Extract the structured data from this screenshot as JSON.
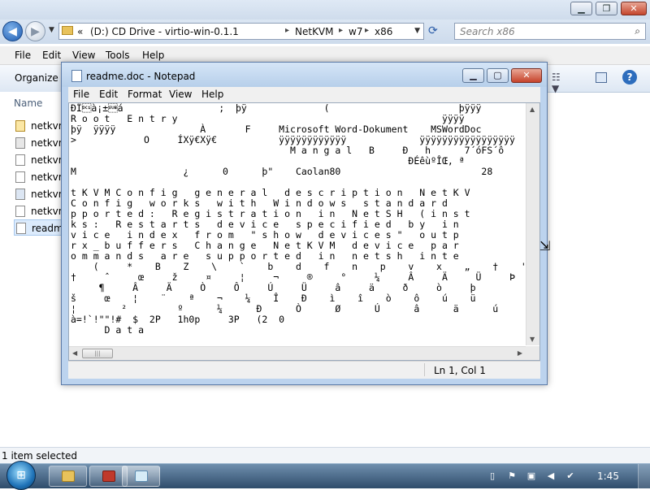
{
  "explorer": {
    "breadcrumb": [
      "«",
      "(D:) CD Drive - virtio-win-0.1.1",
      "NetKVM",
      "w7",
      "x86"
    ],
    "search_placeholder": "Search x86",
    "menu": [
      "File",
      "Edit",
      "View",
      "Tools",
      "Help"
    ],
    "organize_label": "Organize",
    "column_header": "Name",
    "files": [
      {
        "name": "netkvm",
        "icon": "inf-file-icon"
      },
      {
        "name": "netkvm",
        "icon": "gear-file-icon"
      },
      {
        "name": "netkvm",
        "icon": "document-icon"
      },
      {
        "name": "netkvm",
        "icon": "catalog-icon"
      },
      {
        "name": "netkvm",
        "icon": "sys-file-icon"
      },
      {
        "name": "netkvm",
        "icon": "document-icon"
      },
      {
        "name": "readm",
        "icon": "text-file-icon"
      }
    ],
    "status": "1 item selected"
  },
  "notepad": {
    "title": "readme.doc - Notepad",
    "menu": [
      "File",
      "Edit",
      "Format",
      "View",
      "Help"
    ],
    "content": "ÐÏ\u0011à¡±\u001aá                 ;  þÿ     \t     (        \t     \t     þÿÿÿ\nR o o t   E n t r y                                               ÿÿÿÿ\nþÿ  ÿÿÿÿ      \t       À       F     Microsoft Word-Dokument    MSWordDoc  \t  \n>\t     O     ÍXÿ€Xÿ€  \t     ÿÿÿÿÿÿÿÿÿÿÿÿ   \t      ÿÿÿÿÿÿÿÿÿÿÿÿÿÿÿÿÿ\n                                       M a n g a l   B     Ð   h      7´óFS´ô\n                                                            ÐÉêùºÎŒ, ª\nM        \t    ¿      0      þ\"    Caolan80                         28  \n\nt K V M C o n f i g   g e n e r a l   d e s c r i p t i o n   N e t K V\nC o n f i g   w o r k s   w i t h   W i n d o w s   s t a n d a r d\np p o r t e d :   R e g i s t r a t i o n   i n   N e t S H   ( i n s t\nk s :   R e s t a r t s   d e v i c e   s p e c i f i e d   b y   i n\nv i c e   i n d e x   f r o m   \" s h o w   d e v i c e s \"   o u t p\nr x _ b u f f e r s   C h a n g e   N e t K V M   d e v i c e   p a r\no m m a n d s   a r e   s u p p o r t e d   i n   n e t s h   i n t e\n    (     *    B    Z    \\    `    b    d    f    n    p    v    x    „    †    '    \"    ˜    ª    É\n†     ˆ     œ     ž     ¤     ¦     ¬     ®     °     ¼     Â     Ä     Ü     Þ     â     æ     î     ð     ò     ø\n     ¶     Â     Ä     Ò     Ô     Ú     Ü     â     ä     ð     ò     þ               \"     .     0     8\nš     œ    ¦    ¨    ª    ¬    ¼    Î    Ð    ì    î    ò    ô    ú    ü         (    *    <\n¦        ²         º      ¼      Ð      Ò      Ø      Ú      â      ä      ú      ü      !      !      !      *!  ,\nà=!`!\"\"!#  $  2P   1h0p     3P   (2  0\n      D a t a",
    "status_position": "Ln 1, Col 1"
  },
  "taskbar": {
    "clock": "1:45"
  }
}
